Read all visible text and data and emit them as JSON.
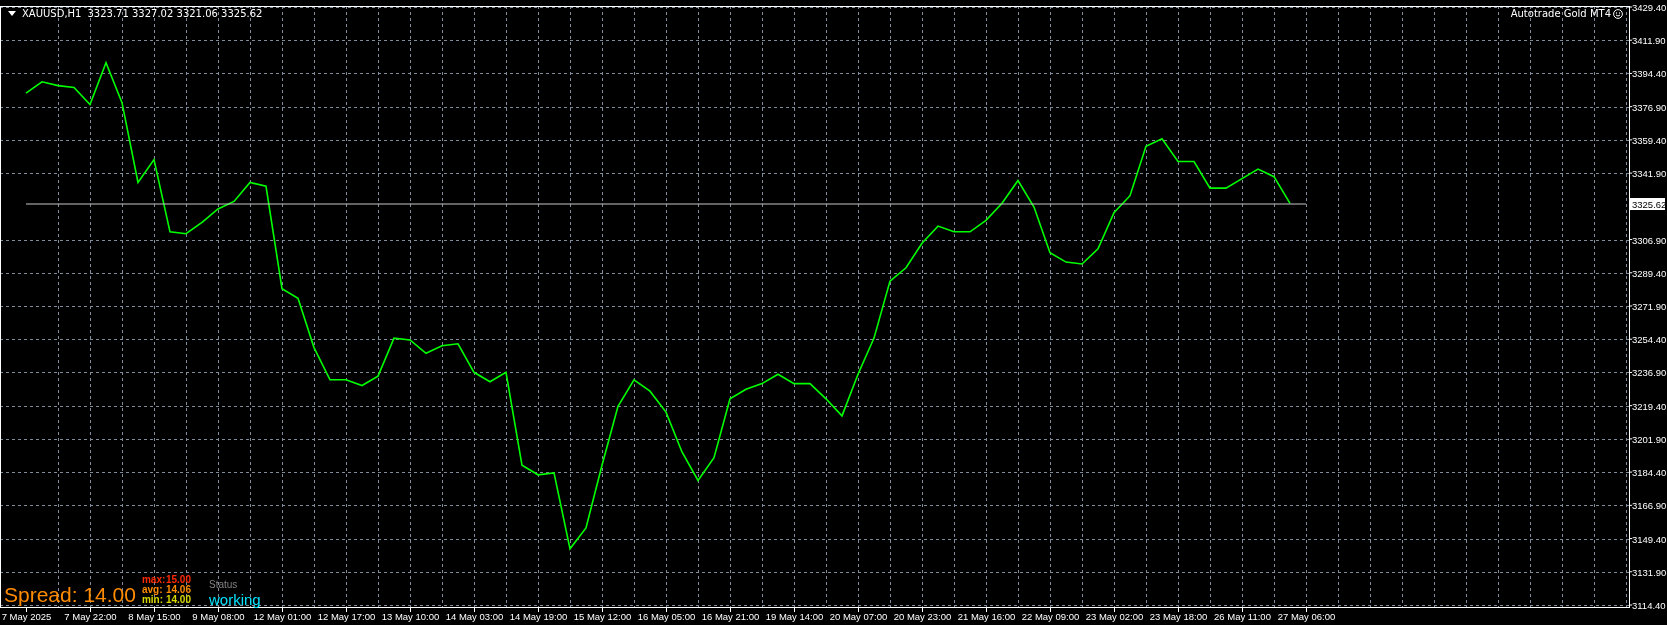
{
  "chart": {
    "header": {
      "ohlc": "3323.71 3327.02 3321.06 3325.62"
    },
    "expert": {
      "name": "Autotrade Gold MT4"
    },
    "chart_data": {
      "type": "line",
      "categories": [
        "7 May 2025",
        null,
        null,
        null,
        "7 May 22:00",
        null,
        null,
        null,
        "8 May 15:00",
        null,
        null,
        null,
        "9 May 08:00",
        null,
        null,
        null,
        "12 May 01:00",
        null,
        null,
        null,
        "12 May 17:00",
        null,
        null,
        null,
        "13 May 10:00",
        null,
        null,
        null,
        "14 May 03:00",
        null,
        null,
        null,
        "14 May 19:00",
        null,
        null,
        null,
        "15 May 12:00",
        null,
        null,
        null,
        "16 May 05:00",
        null,
        null,
        null,
        "16 May 21:00",
        null,
        null,
        null,
        "19 May 14:00",
        null,
        null,
        null,
        "20 May 07:00",
        null,
        null,
        null,
        "20 May 23:00",
        null,
        null,
        null,
        "21 May 16:00",
        null,
        null,
        null,
        "22 May 09:00",
        null,
        null,
        null,
        "23 May 02:00",
        null,
        null,
        null,
        "23 May 18:00",
        null,
        null,
        null,
        "26 May 11:00",
        null,
        null,
        null,
        "27 May 06:00"
      ],
      "series": [
        {
          "name": "XAUUSD,H1",
          "color": "#00ff00",
          "values": [
            3384,
            3390,
            3388,
            3387,
            3378,
            3400,
            3379,
            3337,
            3349,
            3311,
            3310,
            3316,
            3323,
            3327,
            3337,
            3335,
            3281,
            3276,
            3250,
            3233,
            3233,
            3230,
            3235,
            3255,
            3254,
            3247,
            3251,
            3252,
            3237,
            3232,
            3237,
            3188,
            3183,
            3184,
            3144,
            3155,
            3188,
            3219,
            3233,
            3227,
            3216,
            3195,
            3180,
            3192,
            3223,
            3228,
            3231,
            3236,
            3231,
            3231,
            3223,
            3214,
            3236,
            3255,
            3285,
            3292,
            3305,
            3314,
            3311,
            3311,
            3317,
            3326,
            3338,
            3324,
            3300,
            3295,
            3294,
            3302,
            3321,
            3330,
            3356,
            3360,
            3348,
            3348,
            3334,
            3334,
            3339,
            3344,
            3340,
            3326,
            null
          ]
        },
        {
          "color": "#c8c8c8",
          "values": [
            3325.62,
            3325.62,
            3325.62,
            3325.62,
            3325.62,
            3325.62,
            3325.62,
            3325.62,
            3325.62,
            3325.62,
            3325.62,
            3325.62,
            3325.62,
            3325.62,
            3325.62,
            3325.62,
            3325.62,
            3325.62,
            3325.62,
            3325.62,
            3325.62,
            3325.62,
            3325.62,
            3325.62,
            3325.62,
            3325.62,
            3325.62,
            3325.62,
            3325.62,
            3325.62,
            3325.62,
            3325.62,
            3325.62,
            3325.62,
            3325.62,
            3325.62,
            3325.62,
            3325.62,
            3325.62,
            3325.62,
            3325.62,
            3325.62,
            3325.62,
            3325.62,
            3325.62,
            3325.62,
            3325.62,
            3325.62,
            3325.62,
            3325.62,
            3325.62,
            3325.62,
            3325.62,
            3325.62,
            3325.62,
            3325.62,
            3325.62,
            3325.62,
            3325.62,
            3325.62,
            3325.62,
            3325.62,
            3325.62,
            3325.62,
            3325.62,
            3325.62,
            3325.62,
            3325.62,
            3325.62,
            3325.62,
            3325.62,
            3325.62,
            3325.62,
            3325.62,
            3325.62,
            3325.62,
            3325.62,
            3325.62,
            3325.62,
            3325.62,
            3325.62
          ]
        }
      ],
      "grid": true,
      "ylim": [
        3114.4,
        3429.4
      ],
      "yticks": [
        {
          "value": 3429.4,
          "label": "3429.40"
        },
        {
          "value": 3411.9,
          "label": "3411.90"
        },
        {
          "value": 3394.4,
          "label": "3394.40"
        },
        {
          "value": 3376.9,
          "label": "3376.90"
        },
        {
          "value": 3359.4,
          "label": "3359.40"
        },
        {
          "value": 3341.9,
          "label": "3341.90"
        },
        {
          "value": 3325.62,
          "label": "3325.62"
        },
        {
          "value": 3306.9,
          "label": "3306.90"
        },
        {
          "value": 3289.4,
          "label": "3289.40"
        },
        {
          "value": 3271.9,
          "label": "3271.90"
        },
        {
          "value": 3254.4,
          "label": "3254.40"
        },
        {
          "value": 3236.9,
          "label": "3236.90"
        },
        {
          "value": 3219.4,
          "label": "3219.40"
        },
        {
          "value": 3201.9,
          "label": "3201.90"
        },
        {
          "value": 3184.4,
          "label": "3184.40"
        },
        {
          "value": 3166.9,
          "label": "3166.90"
        },
        {
          "value": 3149.4,
          "label": "3149.40"
        },
        {
          "value": 3131.9,
          "label": "3131.90"
        },
        {
          "value": 3114.4,
          "label": "3114.40"
        }
      ]
    }
  },
  "spread_panel": {
    "label": "Spread: 14.00",
    "stats": [
      {
        "label": "max:",
        "value": "15.00",
        "color": "#ff2a00"
      },
      {
        "label": "avg:",
        "value": "14.06",
        "color": "#ff8c00"
      },
      {
        "label": "min:",
        "value": "14.00",
        "color": "#d8d800"
      }
    ],
    "status_label": "Status",
    "status": "working"
  }
}
